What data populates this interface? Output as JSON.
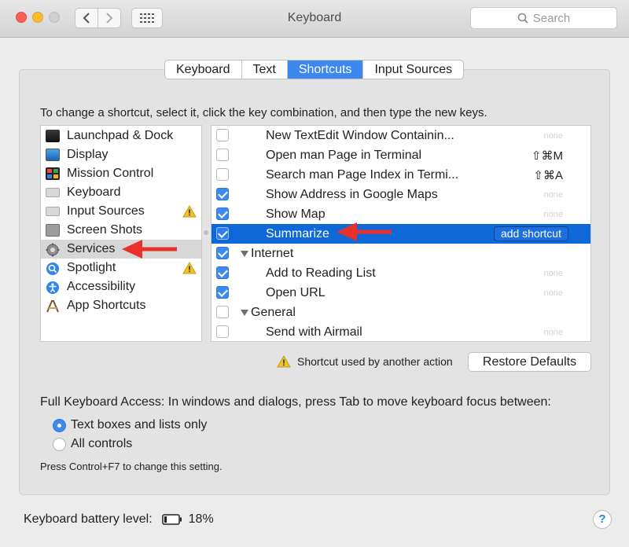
{
  "window": {
    "title": "Keyboard"
  },
  "search": {
    "placeholder": "Search"
  },
  "tabs": [
    {
      "label": "Keyboard",
      "active": false
    },
    {
      "label": "Text",
      "active": false
    },
    {
      "label": "Shortcuts",
      "active": true
    },
    {
      "label": "Input Sources",
      "active": false
    }
  ],
  "instructions": "To change a shortcut, select it, click the key combination, and then type the new keys.",
  "categories": [
    {
      "label": "Launchpad & Dock",
      "icon": "launchpad-icon",
      "warning": false
    },
    {
      "label": "Display",
      "icon": "display-icon",
      "warning": false
    },
    {
      "label": "Mission Control",
      "icon": "mission-control-icon",
      "warning": false
    },
    {
      "label": "Keyboard",
      "icon": "keyboard-icon",
      "warning": false
    },
    {
      "label": "Input Sources",
      "icon": "input-sources-icon",
      "warning": true
    },
    {
      "label": "Screen Shots",
      "icon": "screenshot-icon",
      "warning": false
    },
    {
      "label": "Services",
      "icon": "gear-icon",
      "warning": false,
      "selected": true
    },
    {
      "label": "Spotlight",
      "icon": "spotlight-icon",
      "warning": true
    },
    {
      "label": "Accessibility",
      "icon": "accessibility-icon",
      "warning": false
    },
    {
      "label": "App Shortcuts",
      "icon": "app-shortcuts-icon",
      "warning": false
    }
  ],
  "shortcuts": [
    {
      "label": "New TextEdit Window Containin...",
      "checked": false,
      "key": "none"
    },
    {
      "label": "Open man Page in Terminal",
      "checked": false,
      "key": "⇧⌘M"
    },
    {
      "label": "Search man Page Index in Termi...",
      "checked": false,
      "key": "⇧⌘A"
    },
    {
      "label": "Show Address in Google Maps",
      "checked": true,
      "key": "none"
    },
    {
      "label": "Show Map",
      "checked": true,
      "key": "none"
    },
    {
      "label": "Summarize",
      "checked": true,
      "selected": true,
      "button": "add shortcut"
    },
    {
      "label": "Internet",
      "checked": true,
      "group": true
    },
    {
      "label": "Add to Reading List",
      "checked": true,
      "key": "none"
    },
    {
      "label": "Open URL",
      "checked": true,
      "key": "none"
    },
    {
      "label": "General",
      "checked": false,
      "group": true
    },
    {
      "label": "Send with Airmail",
      "checked": false,
      "key": "none"
    }
  ],
  "conflict_note": "Shortcut used by another action",
  "restore_label": "Restore Defaults",
  "full_keyboard_access": {
    "label": "Full Keyboard Access: In windows and dialogs, press Tab to move keyboard focus between:",
    "options": [
      {
        "label": "Text boxes and lists only",
        "selected": true
      },
      {
        "label": "All controls",
        "selected": false
      }
    ],
    "hint": "Press Control+F7 to change this setting."
  },
  "battery": {
    "label": "Keyboard battery level:",
    "value": "18%",
    "level": 0.18
  },
  "help": {
    "label": "?"
  },
  "colors": {
    "accent": "#3d87ee",
    "selection": "#0f68d9",
    "arrow": "#e8312b",
    "warning": "#f2c12e"
  }
}
